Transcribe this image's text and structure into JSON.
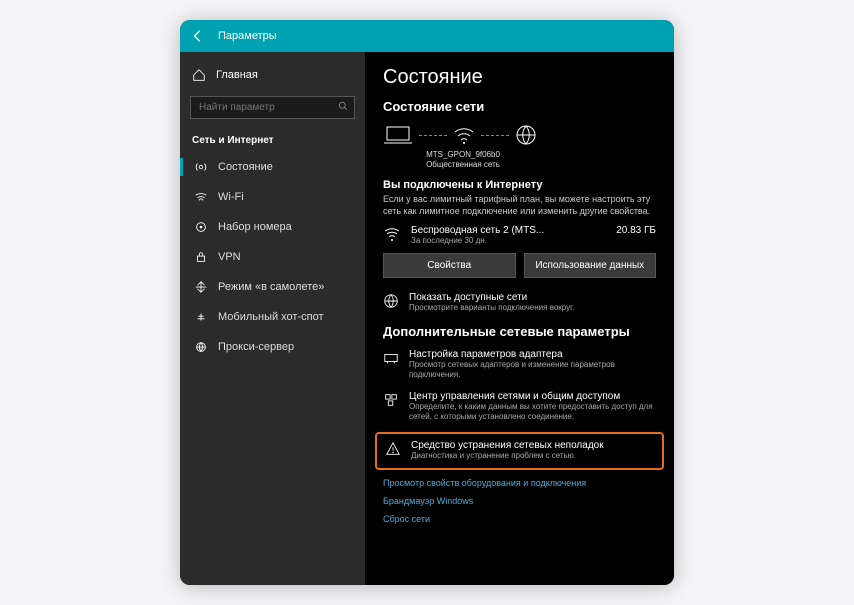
{
  "titlebar": {
    "title": "Параметры"
  },
  "sidebar": {
    "home": "Главная",
    "search_placeholder": "Найти параметр",
    "section": "Сеть и Интернет",
    "items": [
      {
        "label": "Состояние"
      },
      {
        "label": "Wi-Fi"
      },
      {
        "label": "Набор номера"
      },
      {
        "label": "VPN"
      },
      {
        "label": "Режим «в самолете»"
      },
      {
        "label": "Мобильный хот-спот"
      },
      {
        "label": "Прокси-сервер"
      }
    ]
  },
  "content": {
    "heading": "Состояние",
    "sub1": "Состояние сети",
    "diag_name": "MTS_GPON_9f06b0",
    "diag_type": "Общественная сеть",
    "connected_title": "Вы подключены к Интернету",
    "connected_text": "Если у вас лимитный тарифный план, вы можете настроить эту сеть как лимитное подключение или изменить другие свойства.",
    "net_name": "Беспроводная сеть 2 (MTS...",
    "net_sub": "За последние 30 дн.",
    "net_usage": "20.83 ГБ",
    "btn_props": "Свойства",
    "btn_usage": "Использование данных",
    "avail_title": "Показать доступные сети",
    "avail_sub": "Просмотрите варианты подключения вокруг.",
    "sub2": "Дополнительные сетевые параметры",
    "adapter_title": "Настройка параметров адаптера",
    "adapter_sub": "Просмотр сетевых адаптеров и изменение параметров подключения.",
    "sharing_title": "Центр управления сетями и общим доступом",
    "sharing_sub": "Определите, к каким данным вы хотите предоставить доступ для сетей, с которыми установлено соединение.",
    "trouble_title": "Средство устранения сетевых неполадок",
    "trouble_sub": "Диагностика и устранение проблем с сетью.",
    "link1": "Просмотр свойств оборудования и подключения",
    "link2": "Брандмауэр Windows",
    "link3": "Сброс сети"
  }
}
